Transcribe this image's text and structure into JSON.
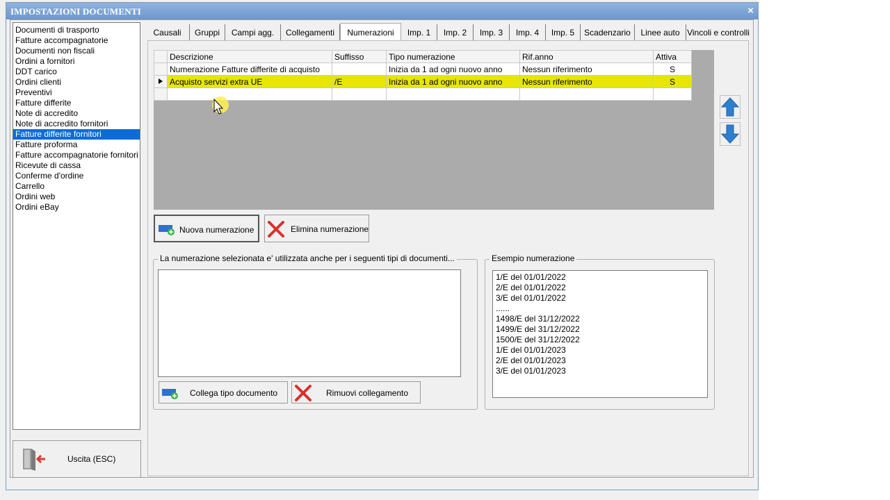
{
  "window": {
    "title": "IMPOSTAZIONI DOCUMENTI",
    "close_symbol": "×"
  },
  "doc_types": [
    "Documenti di trasporto",
    "Fatture accompagnatorie",
    "Documenti non fiscali",
    "Ordini a fornitori",
    "DDT carico",
    "Ordini clienti",
    "Preventivi",
    "Fatture differite",
    "Note di accredito",
    "Note di accredito fornitori",
    "Fatture differite fornitori",
    "Fatture proforma",
    "Fatture accompagnatorie fornitori",
    "Ricevute di cassa",
    "Conferme d'ordine",
    "Carrello",
    "Ordini web",
    "Ordini eBay"
  ],
  "selected_doc_type": "Fatture differite fornitori",
  "exit_button": {
    "label": "Uscita (ESC)",
    "icon": "exit-door-icon"
  },
  "tabs": [
    "Causali",
    "Gruppi",
    "Campi agg.",
    "Collegamenti",
    "Numerazioni",
    "Imp. 1",
    "Imp. 2",
    "Imp. 3",
    "Imp. 4",
    "Imp. 5",
    "Scadenzario",
    "Linee auto",
    "Vincoli e controlli"
  ],
  "active_tab": "Numerazioni",
  "grid": {
    "columns": [
      "Descrizione",
      "Suffisso",
      "Tipo numerazione",
      "Rif.anno",
      "Attiva"
    ],
    "rows": [
      [
        "Numerazione Fatture differite di acquisto",
        "",
        "Inizia da 1 ad ogni nuovo anno",
        "Nessun riferimento",
        "S"
      ],
      [
        "Acquisto servizi extra UE",
        "/E",
        "Inizia da 1 ad ogni nuovo anno",
        "Nessun riferimento",
        "S"
      ],
      [
        "",
        "",
        "",
        "",
        ""
      ]
    ],
    "highlight_color": "#e6e600"
  },
  "buttons": {
    "new_numbering": "Nuova numerazione",
    "delete_numbering": "Elimina numerazione",
    "link_doc_type": "Collega tipo documento",
    "remove_link": "Rimuovi collegamento"
  },
  "linked_group": {
    "legend": "La numerazione selezionata e' utilizzata anche per i seguenti tipi di documenti..."
  },
  "example_group": {
    "legend": "Esempio numerazione",
    "lines": [
      "1/E del 01/01/2022",
      "2/E del 01/01/2022",
      "3/E del 01/01/2022",
      "......",
      "1498/E del 31/12/2022",
      "1499/E del 31/12/2022",
      "1500/E del 31/12/2022",
      "1/E del 01/01/2023",
      "2/E del 01/01/2023",
      "3/E del 01/01/2023"
    ]
  },
  "colors": {
    "accent_blue": "#0a6cd6",
    "arrow_blue": "#2f7fd0",
    "delete_red": "#d9302a"
  }
}
